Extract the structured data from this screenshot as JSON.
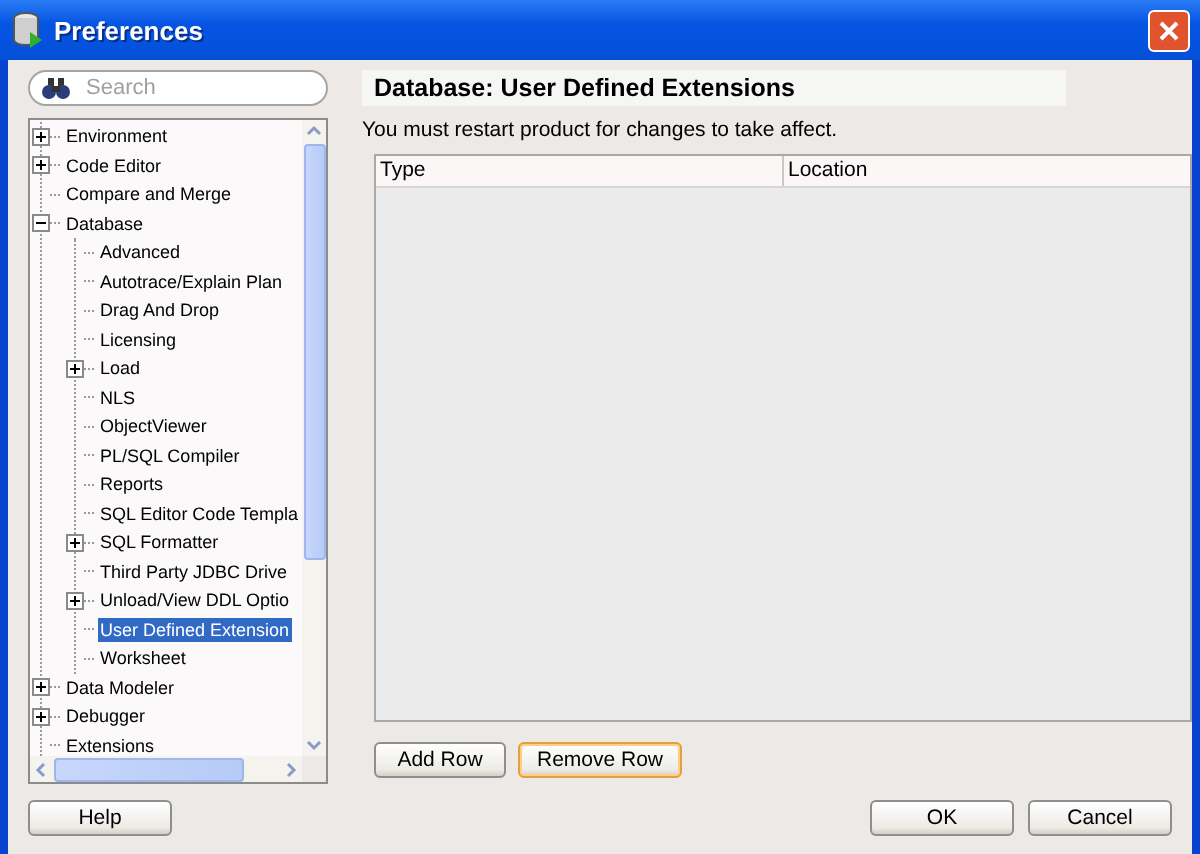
{
  "window": {
    "title": "Preferences"
  },
  "search": {
    "placeholder": "Search"
  },
  "tree": [
    {
      "label": "Environment",
      "kind": "group",
      "expanded": false,
      "selected": false
    },
    {
      "label": "Code Editor",
      "kind": "group",
      "expanded": false,
      "selected": false
    },
    {
      "label": "Compare and Merge",
      "kind": "leaf",
      "selected": false
    },
    {
      "label": "Database",
      "kind": "group",
      "expanded": true,
      "selected": false,
      "children": [
        {
          "label": "Advanced",
          "kind": "leaf",
          "selected": false
        },
        {
          "label": "Autotrace/Explain Plan",
          "kind": "leaf",
          "selected": false
        },
        {
          "label": "Drag And Drop",
          "kind": "leaf",
          "selected": false
        },
        {
          "label": "Licensing",
          "kind": "leaf",
          "selected": false
        },
        {
          "label": "Load",
          "kind": "group",
          "expanded": false,
          "selected": false
        },
        {
          "label": "NLS",
          "kind": "leaf",
          "selected": false
        },
        {
          "label": "ObjectViewer",
          "kind": "leaf",
          "selected": false
        },
        {
          "label": "PL/SQL Compiler",
          "kind": "leaf",
          "selected": false
        },
        {
          "label": "Reports",
          "kind": "leaf",
          "selected": false
        },
        {
          "label": "SQL Editor Code Templa",
          "kind": "leaf",
          "selected": false
        },
        {
          "label": "SQL Formatter",
          "kind": "group",
          "expanded": false,
          "selected": false
        },
        {
          "label": "Third Party JDBC Drive",
          "kind": "leaf",
          "selected": false
        },
        {
          "label": "Unload/View DDL Optio",
          "kind": "group",
          "expanded": false,
          "selected": false
        },
        {
          "label": "User Defined Extension",
          "kind": "leaf",
          "selected": true
        },
        {
          "label": "Worksheet",
          "kind": "leaf",
          "selected": false
        }
      ]
    },
    {
      "label": "Data Modeler",
      "kind": "group",
      "expanded": false,
      "selected": false
    },
    {
      "label": "Debugger",
      "kind": "group",
      "expanded": false,
      "selected": false
    },
    {
      "label": "Extensions",
      "kind": "leaf",
      "selected": false
    }
  ],
  "panel": {
    "title": "Database: User Defined Extensions",
    "message": "You must restart product for changes to take affect.",
    "table": {
      "columns": [
        "Type",
        "Location"
      ]
    },
    "buttons": [
      {
        "label": "Add Row",
        "focused": false
      },
      {
        "label": "Remove Row",
        "focused": true
      }
    ]
  },
  "footer": {
    "help": "Help",
    "ok": "OK",
    "cancel": "Cancel"
  }
}
